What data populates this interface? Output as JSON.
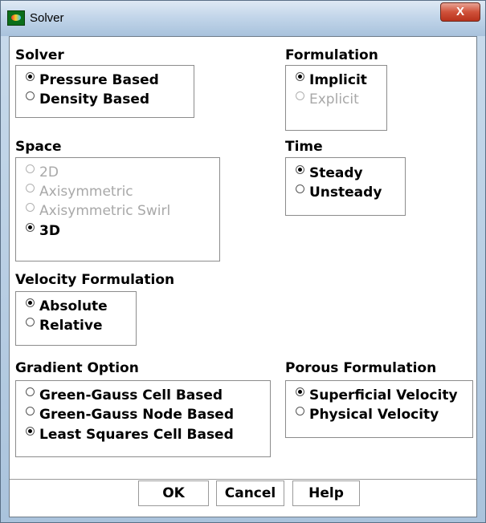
{
  "window": {
    "title": "Solver",
    "close_glyph": "X"
  },
  "solver": {
    "title": "Solver",
    "options": [
      "Pressure Based",
      "Density Based"
    ],
    "selected": "Pressure Based"
  },
  "formulation": {
    "title": "Formulation",
    "options": [
      "Implicit",
      "Explicit"
    ],
    "selected": "Implicit",
    "disabled": [
      "Explicit"
    ]
  },
  "space": {
    "title": "Space",
    "options": [
      "2D",
      "Axisymmetric",
      "Axisymmetric Swirl",
      "3D"
    ],
    "selected": "3D",
    "disabled": [
      "2D",
      "Axisymmetric",
      "Axisymmetric Swirl"
    ]
  },
  "time": {
    "title": "Time",
    "options": [
      "Steady",
      "Unsteady"
    ],
    "selected": "Steady"
  },
  "velocity_formulation": {
    "title": "Velocity Formulation",
    "options": [
      "Absolute",
      "Relative"
    ],
    "selected": "Absolute"
  },
  "gradient_option": {
    "title": "Gradient Option",
    "options": [
      "Green-Gauss Cell Based",
      "Green-Gauss Node Based",
      "Least Squares Cell Based"
    ],
    "selected": "Least Squares Cell Based"
  },
  "porous_formulation": {
    "title": "Porous Formulation",
    "options": [
      "Superficial Velocity",
      "Physical Velocity"
    ],
    "selected": "Superficial Velocity"
  },
  "buttons": {
    "ok": "OK",
    "cancel": "Cancel",
    "help": "Help"
  },
  "colors": {
    "disabled_text": "#a8a8a8",
    "titlebar": "#c3d6ea",
    "close_button": "#d0513a"
  }
}
